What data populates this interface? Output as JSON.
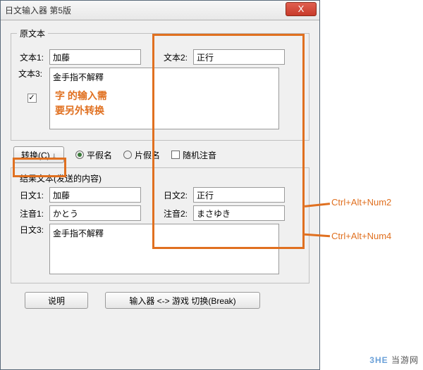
{
  "window": {
    "title": "日文输入器 第5版",
    "close_label": "X"
  },
  "source": {
    "legend": "原文本",
    "label1": "文本1:",
    "value1": "加藤",
    "label2": "文本2:",
    "value2": "正行",
    "label3": "文本3:",
    "value3": "金手指不解釋",
    "checkbox_mark": "✓",
    "note_line1": "字 的输入需",
    "note_line2": "要另外转换"
  },
  "convert": {
    "button": "转换(C) ↓",
    "radio_hiragana": "平假名",
    "radio_katakana": "片假名",
    "check_random": "随机注音"
  },
  "result": {
    "legend": "结果文本(发送的内容)",
    "jp1_label": "日文1:",
    "jp1_value": "加藤",
    "jp2_label": "日文2:",
    "jp2_value": "正行",
    "yomi1_label": "注音1:",
    "yomi1_value": "かとう",
    "yomi2_label": "注音2:",
    "yomi2_value": "まさゆき",
    "jp3_label": "日文3:",
    "jp3_value": "金手指不解釋"
  },
  "bottom": {
    "explain": "说明",
    "switch": "输入器 <-> 游戏 切换(Break)"
  },
  "callouts": {
    "c1": "Ctrl+Alt+Num2",
    "c2": "Ctrl+Alt+Num4"
  },
  "watermark": {
    "brand": "3HE",
    "text": "当游网"
  }
}
